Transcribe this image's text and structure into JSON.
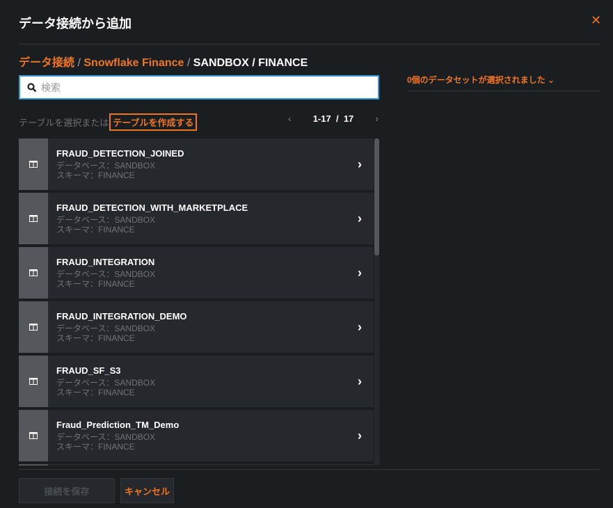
{
  "dialog": {
    "title": "データ接続から追加"
  },
  "breadcrumb": {
    "root": "データ接続",
    "connection": "Snowflake Finance",
    "sep": "/",
    "current": "SANDBOX / FINANCE"
  },
  "search": {
    "placeholder": "検索",
    "value": ""
  },
  "hint": {
    "text": "テーブルを選択または",
    "create_label": "テーブルを作成する"
  },
  "pagination": {
    "range": "1-17",
    "sep": "/",
    "total": "17"
  },
  "tables": [
    {
      "name": "FRAUD_DETECTION_JOINED",
      "database": "データベース：SANDBOX",
      "schema": "スキーマ：FINANCE"
    },
    {
      "name": "FRAUD_DETECTION_WITH_MARKETPLACE",
      "database": "データベース：SANDBOX",
      "schema": "スキーマ：FINANCE"
    },
    {
      "name": "FRAUD_INTEGRATION",
      "database": "データベース：SANDBOX",
      "schema": "スキーマ：FINANCE"
    },
    {
      "name": "FRAUD_INTEGRATION_DEMO",
      "database": "データベース：SANDBOX",
      "schema": "スキーマ：FINANCE"
    },
    {
      "name": "FRAUD_SF_S3",
      "database": "データベース：SANDBOX",
      "schema": "スキーマ：FINANCE"
    },
    {
      "name": "Fraud_Prediction_TM_Demo",
      "database": "データベース：SANDBOX",
      "schema": "スキーマ：FINANCE"
    }
  ],
  "selection": {
    "label": "0個のデータセットが選択されました"
  },
  "footer": {
    "save_label": "接続を保存",
    "cancel_label": "キャンセル"
  },
  "colors": {
    "accent": "#ee7623",
    "background": "#1b1e21",
    "card": "#25292d"
  }
}
